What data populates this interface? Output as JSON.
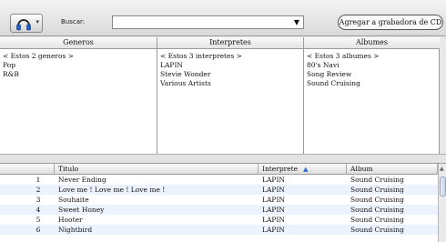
{
  "toolbar": {
    "view_icon": "headphones-icon",
    "dropdown_glyph": "▾",
    "search_label": "Buscar:",
    "search_value": "",
    "search_arrow": "▼",
    "burn_label": "Agregar a grabadora de CD"
  },
  "browser": {
    "panes": [
      {
        "header": "Generos",
        "items": [
          "< Estos 2 generos >",
          "Pop",
          "R&B"
        ]
      },
      {
        "header": "Interpretes",
        "items": [
          "< Estos 3 interpretes >",
          "LAPIN",
          "Stevie Wonder",
          "Various Artists"
        ]
      },
      {
        "header": "Albumes",
        "items": [
          "< Estos 3 albumes >",
          "80's Navi",
          "Song Review",
          "Sound Cruising"
        ]
      }
    ]
  },
  "tracks": {
    "columns": {
      "number": "",
      "title": "Titulo",
      "artist": "Interprete",
      "album": "Album"
    },
    "sort_indicator": "▲",
    "rows": [
      {
        "num": "1",
        "title": "Never Ending",
        "artist": "LAPIN",
        "album": "Sound Cruising"
      },
      {
        "num": "2",
        "title": "Love me ! Love me ! Love me !",
        "artist": "LAPIN",
        "album": "Sound Cruising"
      },
      {
        "num": "3",
        "title": "Souhaite",
        "artist": "LAPIN",
        "album": "Sound Cruising"
      },
      {
        "num": "4",
        "title": "Sweet Honey",
        "artist": "LAPIN",
        "album": "Sound Cruising"
      },
      {
        "num": "5",
        "title": "Hooter",
        "artist": "LAPIN",
        "album": "Sound Cruising"
      },
      {
        "num": "6",
        "title": "Nightbird",
        "artist": "LAPIN",
        "album": "Sound Cruising"
      }
    ]
  },
  "colors": {
    "stripe": "#edf3fe",
    "sort_arrow": "#2c6bd6"
  }
}
